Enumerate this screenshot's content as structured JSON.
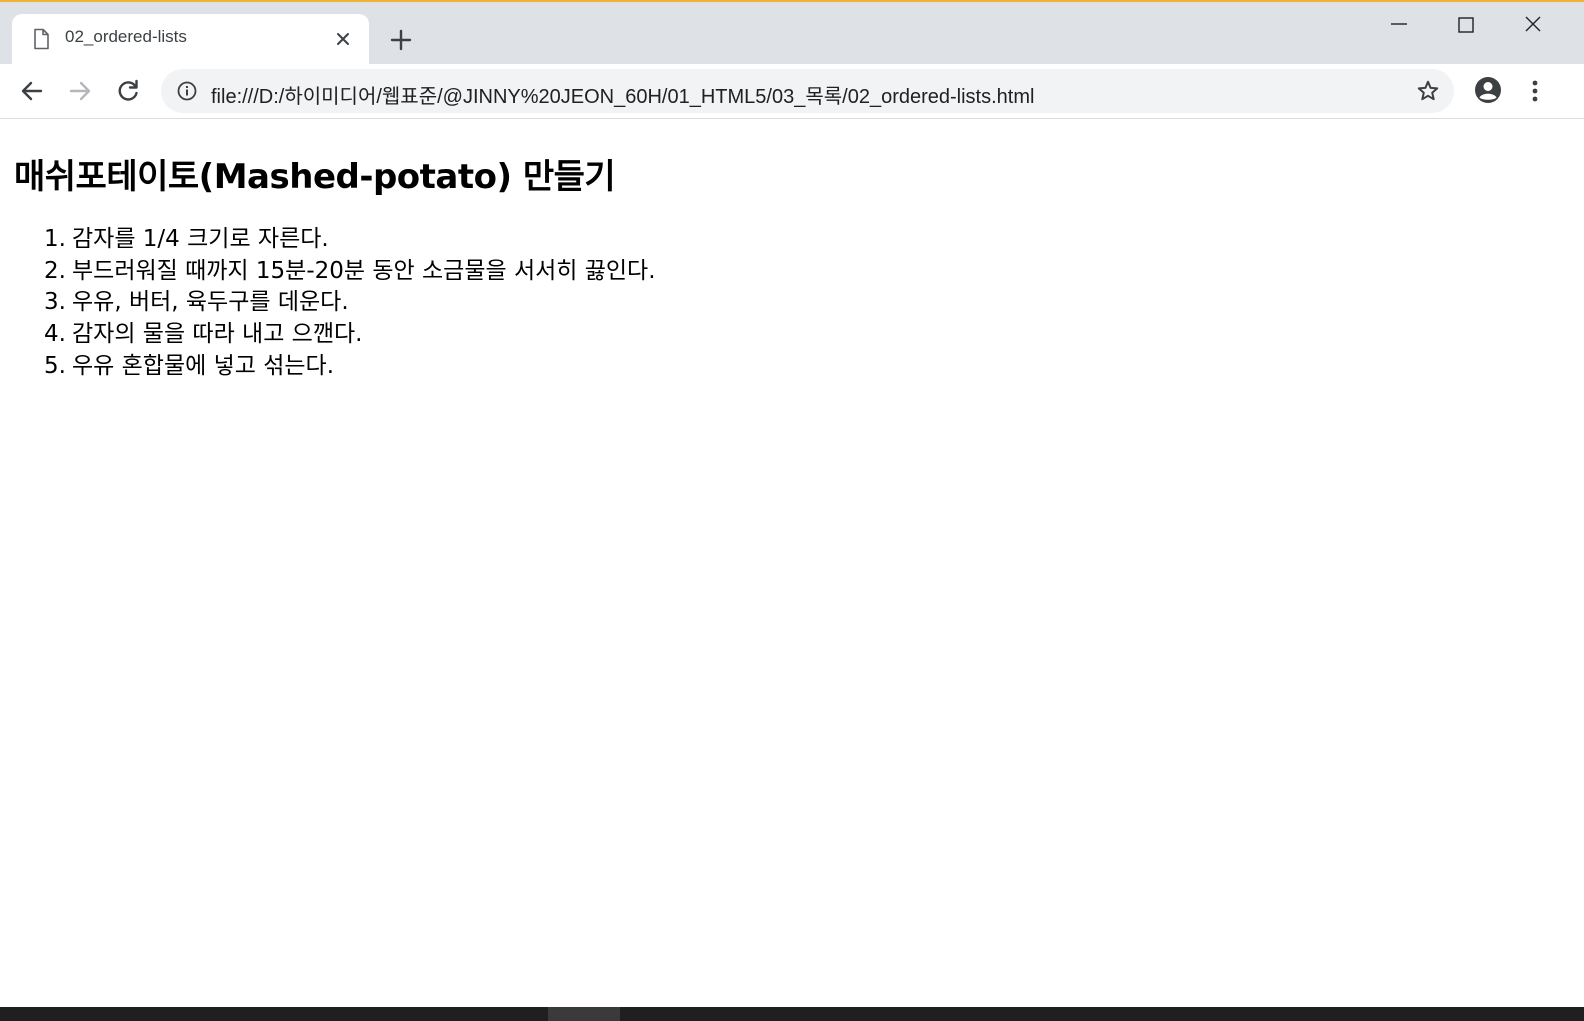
{
  "browser": {
    "tab": {
      "title": "02_ordered-lists",
      "icon": "document-icon"
    },
    "address_bar": {
      "url": "file:///D:/하이미디어/웹표준/@JINNY%20JEON_60H/01_HTML5/03_목록/02_ordered-lists.html"
    },
    "accent_color": "#f2b233"
  },
  "page": {
    "heading": "매쉬포테이토(Mashed-potato) 만들기",
    "steps": [
      {
        "number": "1.",
        "text": "감자를 1/4 크기로 자른다."
      },
      {
        "number": "2.",
        "text": "부드러워질 때까지 15분-20분 동안 소금물을 서서히 끓인다."
      },
      {
        "number": "3.",
        "text": "우유, 버터, 육두구를 데운다."
      },
      {
        "number": "4.",
        "text": "감자의 물을 따라 내고 으깬다."
      },
      {
        "number": "5.",
        "text": "우유 혼합물에 넣고 섞는다."
      }
    ]
  }
}
